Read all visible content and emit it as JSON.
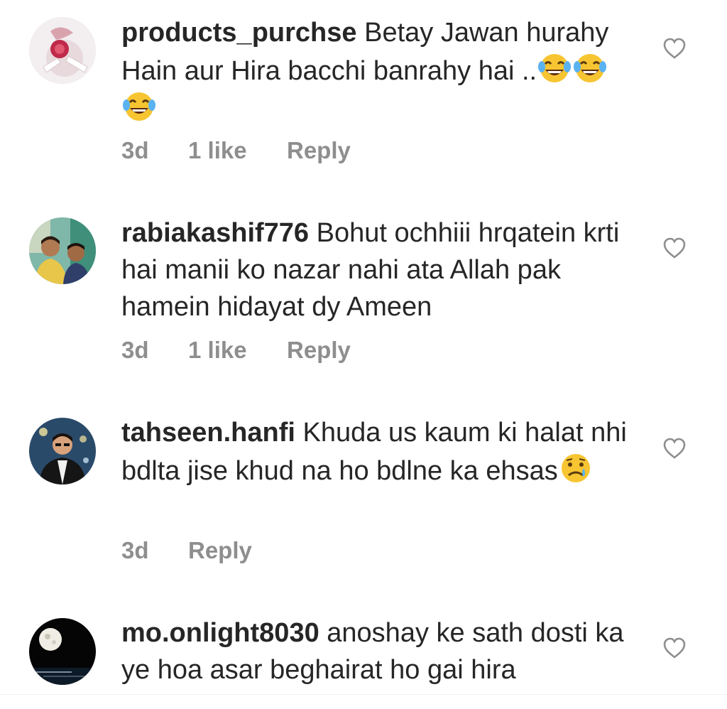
{
  "comments": [
    {
      "username": "products_purchse",
      "text_before_emoji": "Betay Jawan hurahy Hain aur Hira bacchi banrahy hai ..",
      "emojis": [
        "laughing-tears-emoji",
        "laughing-tears-emoji",
        "laughing-tears-emoji"
      ],
      "time": "3d",
      "likes": "1 like",
      "reply": "Reply"
    },
    {
      "username": "rabiakashif776",
      "text_before_emoji": "Bohut ochhiii hrqatein krti hai manii ko nazar nahi ata Allah pak hamein hidayat dy Ameen",
      "emojis": [],
      "time": "3d",
      "likes": "1 like",
      "reply": "Reply"
    },
    {
      "username": "tahseen.hanfi",
      "text_before_emoji": "Khuda us kaum ki halat nhi bdlta jise khud na ho bdlne ka ehsas",
      "emojis": [
        "crying-face-emoji"
      ],
      "time": "3d",
      "likes": "",
      "reply": "Reply"
    },
    {
      "username": "mo.onlight8030",
      "text_before_emoji": "anoshay ke sath dosti ka ye hoa asar beghairat ho gai hira",
      "emojis": [],
      "time": "",
      "likes": "",
      "reply": ""
    }
  ],
  "icons": {
    "like": "heart-outline-icon"
  },
  "colors": {
    "text": "#262626",
    "meta": "#8e8e8e",
    "heart": "#8e8e8e"
  }
}
